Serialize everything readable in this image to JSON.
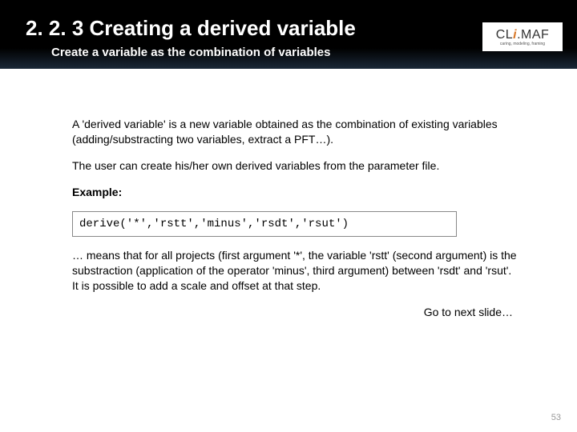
{
  "header": {
    "title": "2. 2. 3 Creating a derived variable",
    "subtitle": "Create a variable as the combination of variables"
  },
  "logo": {
    "text": "CliMAF",
    "tagline": "caring, modeling, framing"
  },
  "body": {
    "p1": "A 'derived variable' is a new variable obtained as the combination of existing variables (adding/substracting two variables, extract a PFT…).",
    "p2": "The user can create his/her own derived variables from the parameter file.",
    "example_label": "Example:",
    "code": "derive('*','rstt','minus','rsdt','rsut')",
    "p3": "… means that for all projects (first argument '*', the variable 'rstt' (second argument) is the substraction (application of the operator 'minus', third argument) between 'rsdt' and 'rsut'.\nIt is possible to add a scale and offset at that step.",
    "next": "Go to next slide…"
  },
  "page_number": "53"
}
